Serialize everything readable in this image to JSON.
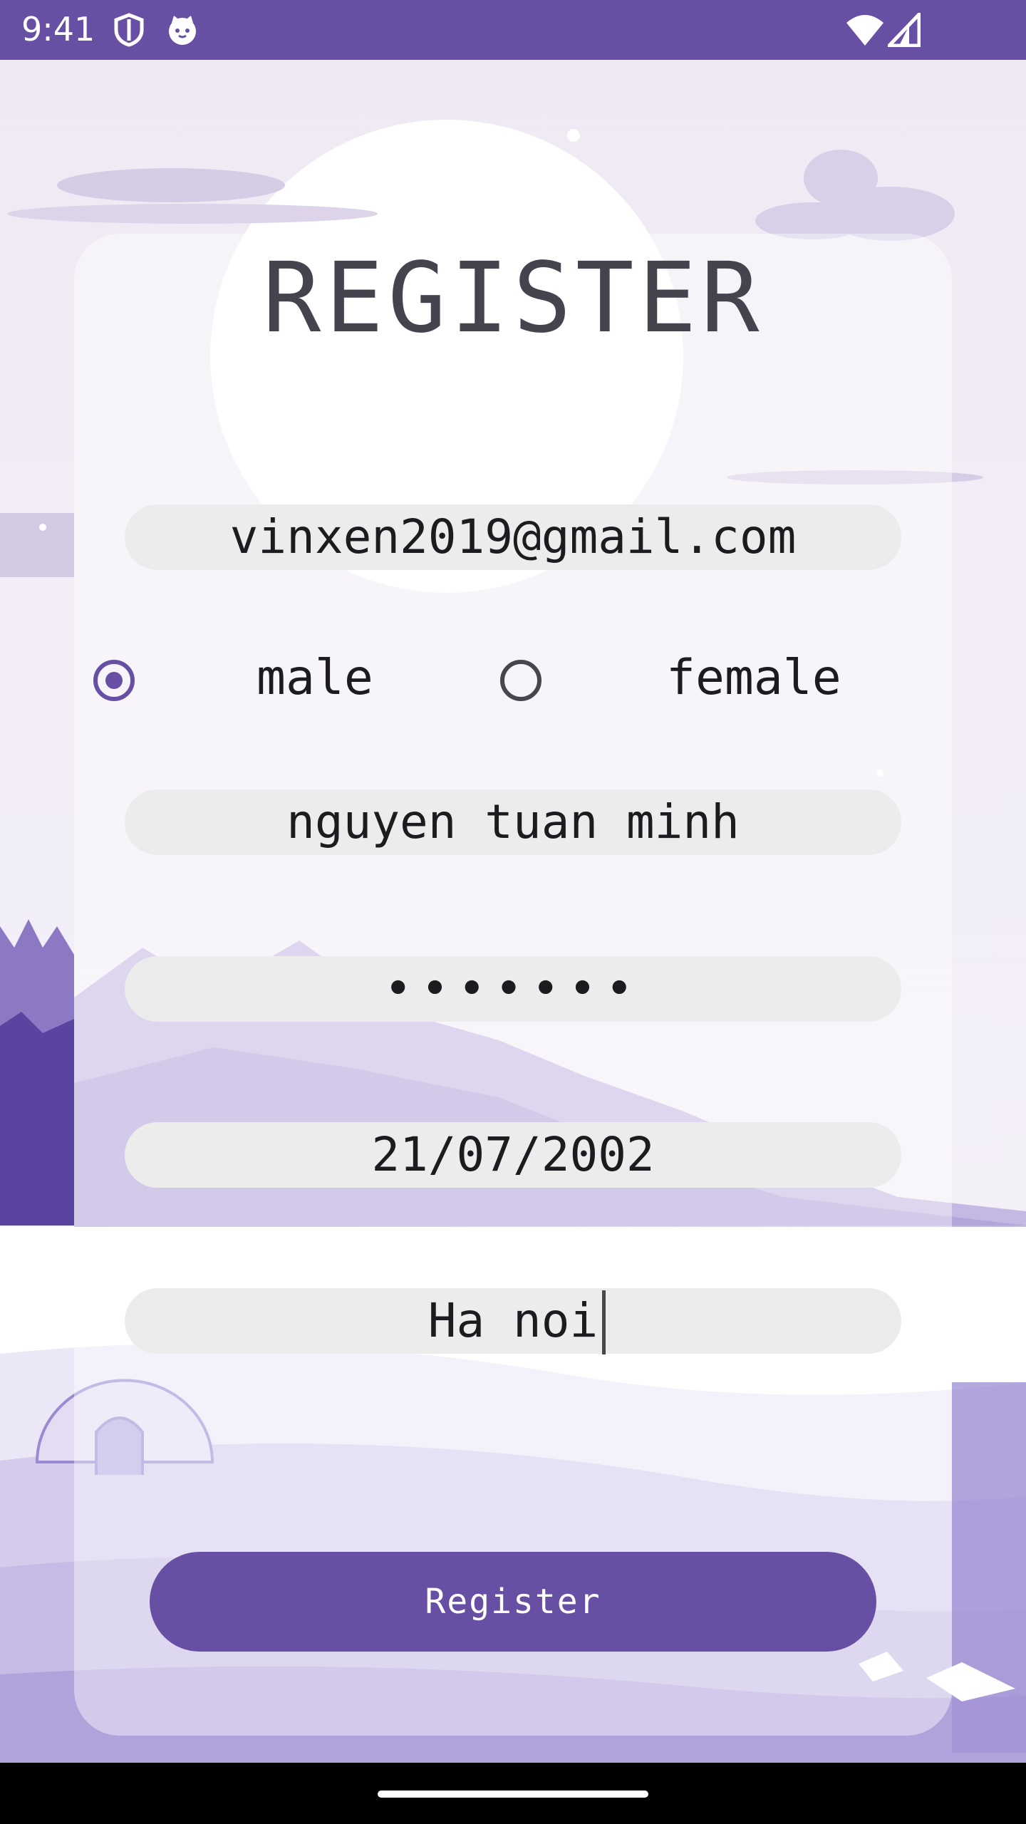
{
  "status_bar": {
    "time": "9:41",
    "background": "#6750a4",
    "left_icons": [
      "shield-icon",
      "cat-icon"
    ],
    "right_icons": [
      "wifi-icon",
      "signal-icon"
    ]
  },
  "page": {
    "title": "REGISTER"
  },
  "form": {
    "email": "vinxen2019@gmail.com",
    "gender": {
      "selected": "male",
      "options": [
        "male",
        "female"
      ]
    },
    "name": "nguyen tuan minh",
    "password_mask": "•••••••",
    "dob": "21/07/2002",
    "address": "Ha noi",
    "submit_label": "Register"
  },
  "colors": {
    "accent": "#6750a4",
    "field_bg": "#ececec",
    "title": "#46434f"
  }
}
